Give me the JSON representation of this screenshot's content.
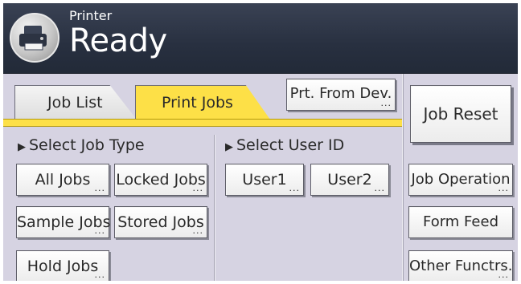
{
  "header": {
    "subtitle": "Printer",
    "status": "Ready",
    "icon": "printer-icon"
  },
  "tabs": [
    {
      "label": "Job List",
      "active": false
    },
    {
      "label": "Print Jobs",
      "active": true
    }
  ],
  "prt_from_dev_label": "Prt. From Dev.",
  "job_type": {
    "title": "Select Job Type",
    "buttons": [
      "All Jobs",
      "Locked Jobs",
      "Sample Jobs",
      "Stored Jobs",
      "Hold Jobs"
    ]
  },
  "user_id": {
    "title": "Select User ID",
    "buttons": [
      "User1",
      "User2"
    ]
  },
  "side_buttons": {
    "job_reset": "Job Reset",
    "job_operation": "Job Operation",
    "form_feed": "Form Feed",
    "other_functrs": "Other Functrs."
  },
  "colors": {
    "header_bg": "#283040",
    "panel_bg": "#d6d3e2",
    "active_tab": "#fde047"
  }
}
